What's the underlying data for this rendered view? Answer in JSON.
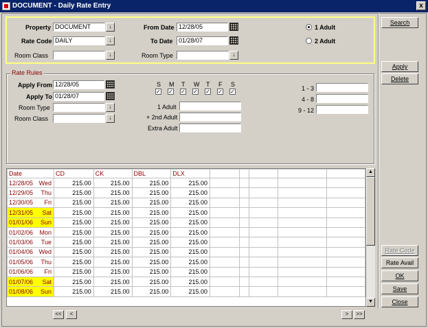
{
  "window": {
    "title": "DOCUMENT - Daily Rate Entry",
    "close_glyph": "x"
  },
  "header": {
    "property_label": "Property",
    "property_value": "DOCUMENT",
    "rate_code_label": "Rate Code",
    "rate_code_value": "DAILY",
    "room_class_label": "Room Class",
    "room_class_value": "",
    "from_date_label": "From Date",
    "from_date_value": "12/28/05",
    "to_date_label": "To Date",
    "to_date_value": "01/28/07",
    "room_type_label": "Room Type",
    "room_type_value": "",
    "adult1_label": "1 Adult",
    "adult2_label": "2 Adult",
    "selected_adults": "1 Adult"
  },
  "rate_rules": {
    "title": "Rate Rules",
    "apply_from_label": "Apply From",
    "apply_from_value": "12/28/05",
    "apply_to_label": "Apply To",
    "apply_to_value": "01/28/07",
    "room_type_label": "Room Type",
    "room_type_value": "",
    "room_class_label": "Room Class",
    "room_class_value": "",
    "days": [
      "S",
      "M",
      "T",
      "W",
      "T",
      "F",
      "S"
    ],
    "days_checked": [
      true,
      true,
      true,
      true,
      true,
      true,
      true
    ],
    "adult1_label": "1 Adult",
    "adult1_value": "",
    "second_adult_label": "+ 2nd Adult",
    "second_adult_value": "",
    "extra_adult_label": "Extra Adult",
    "extra_adult_value": "",
    "range1_label": "1 - 3",
    "range1_value": "",
    "range2_label": "4 - 8",
    "range2_value": "",
    "range3_label": "9 - 12",
    "range3_value": ""
  },
  "buttons": {
    "search": "Search",
    "apply": "Apply",
    "delete": "Delete",
    "rate_code": "Rate Code",
    "rate_avail": "Rate Avail",
    "ok": "OK",
    "save": "Save",
    "close": "Close"
  },
  "grid": {
    "columns": [
      "Date",
      "CD",
      "CK",
      "DBL",
      "DLX",
      "",
      "",
      "",
      "",
      ""
    ],
    "rows": [
      {
        "date": "12/28/05",
        "day": "Wed",
        "weekend": false,
        "values": [
          "215.00",
          "215.00",
          "215.00",
          "215.00"
        ]
      },
      {
        "date": "12/29/05",
        "day": "Thu",
        "weekend": false,
        "values": [
          "215.00",
          "215.00",
          "215.00",
          "215.00"
        ]
      },
      {
        "date": "12/30/05",
        "day": "Fri",
        "weekend": false,
        "values": [
          "215.00",
          "215.00",
          "215.00",
          "215.00"
        ]
      },
      {
        "date": "12/31/05",
        "day": "Sat",
        "weekend": true,
        "values": [
          "215.00",
          "215.00",
          "215.00",
          "215.00"
        ]
      },
      {
        "date": "01/01/06",
        "day": "Sun",
        "weekend": true,
        "values": [
          "215.00",
          "215.00",
          "215.00",
          "215.00"
        ]
      },
      {
        "date": "01/02/06",
        "day": "Mon",
        "weekend": false,
        "values": [
          "215.00",
          "215.00",
          "215.00",
          "215.00"
        ]
      },
      {
        "date": "01/03/06",
        "day": "Tue",
        "weekend": false,
        "values": [
          "215.00",
          "215.00",
          "215.00",
          "215.00"
        ]
      },
      {
        "date": "01/04/06",
        "day": "Wed",
        "weekend": false,
        "values": [
          "215.00",
          "215.00",
          "215.00",
          "215.00"
        ]
      },
      {
        "date": "01/05/06",
        "day": "Thu",
        "weekend": false,
        "values": [
          "215.00",
          "215.00",
          "215.00",
          "215.00"
        ]
      },
      {
        "date": "01/06/06",
        "day": "Fri",
        "weekend": false,
        "values": [
          "215.00",
          "215.00",
          "215.00",
          "215.00"
        ]
      },
      {
        "date": "01/07/06",
        "day": "Sat",
        "weekend": true,
        "values": [
          "215.00",
          "215.00",
          "215.00",
          "215.00"
        ]
      },
      {
        "date": "01/08/06",
        "day": "Sun",
        "weekend": true,
        "values": [
          "215.00",
          "215.00",
          "215.00",
          "215.00"
        ]
      }
    ]
  },
  "nav": {
    "first": "<<",
    "prev": "<",
    "next": ">",
    "last": ">>"
  },
  "icons": {
    "dropdown": "down-arrow-icon",
    "calendar": "calendar-icon"
  },
  "colors": {
    "title_bar": "#0a246a",
    "weekend_highlight": "#ffff00",
    "header_text": "#8b0000",
    "focus_frame": "#ffff80"
  }
}
